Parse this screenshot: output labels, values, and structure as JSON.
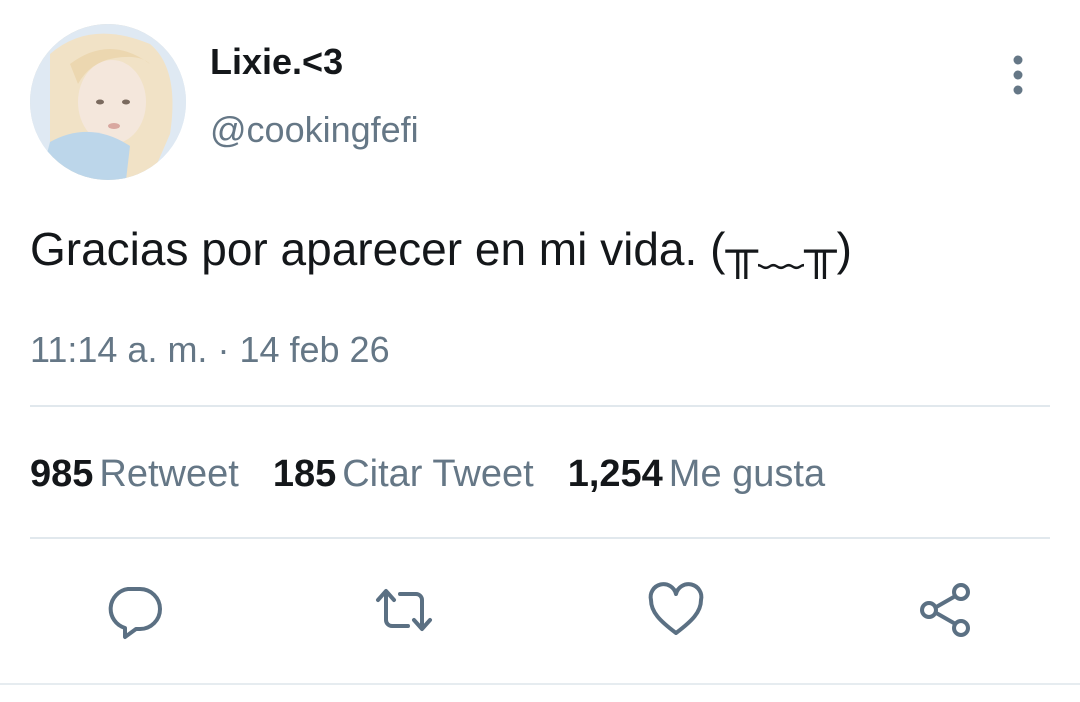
{
  "user": {
    "display_name": "Lixie.<3",
    "handle": "@cookingfefi",
    "avatar_icon": "profile-photo"
  },
  "tweet": {
    "text": "Gracias por aparecer en mi vida. (╥﹏╥)",
    "time": "11:14 a. m.",
    "separator": "·",
    "date": "14 feb 26"
  },
  "stats": {
    "retweets": {
      "count": "985",
      "label": "Retweet"
    },
    "quotes": {
      "count": "185",
      "label": "Citar Tweet"
    },
    "likes": {
      "count": "1,254",
      "label": "Me gusta"
    }
  },
  "actions": {
    "reply_icon": "speech-bubble-icon",
    "retweet_icon": "retweet-icon",
    "like_icon": "heart-icon",
    "share_icon": "share-icon",
    "more_icon": "vertical-ellipsis-icon"
  },
  "colors": {
    "primary_text": "#14171a",
    "secondary_text": "#657786",
    "icon": "#5b7083",
    "divider": "#e1e8ed"
  }
}
